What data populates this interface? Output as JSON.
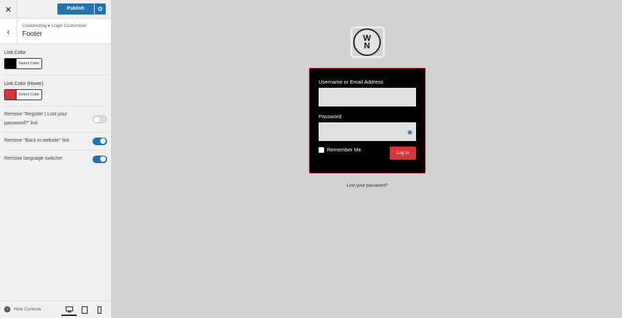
{
  "sidebar": {
    "publish_label": "Publish",
    "breadcrumb": "Customizing ▸ Login Customizer",
    "section_title": "Footer",
    "link_color": {
      "label": "Link Color",
      "swatch": "#000000",
      "button": "Select Color"
    },
    "link_color_hover": {
      "label": "Link Color (Hover)",
      "swatch": "#d63638",
      "button": "Select Color"
    },
    "toggles": [
      {
        "label": "Remove \"Register | Lost your password?\" link",
        "on": false
      },
      {
        "label": "Remove \"Back to website\" link",
        "on": true
      },
      {
        "label": "Remove language switcher",
        "on": true
      }
    ],
    "hide_controls": "Hide Controls"
  },
  "preview": {
    "logo_top": "W",
    "logo_bottom": "N",
    "username_label": "Username or Email Address",
    "password_label": "Password",
    "remember_label": "Remember Me",
    "login_button": "Log In",
    "lost_password": "Lost your password?"
  },
  "colors": {
    "accent": "#2271b1",
    "danger": "#d63638"
  }
}
